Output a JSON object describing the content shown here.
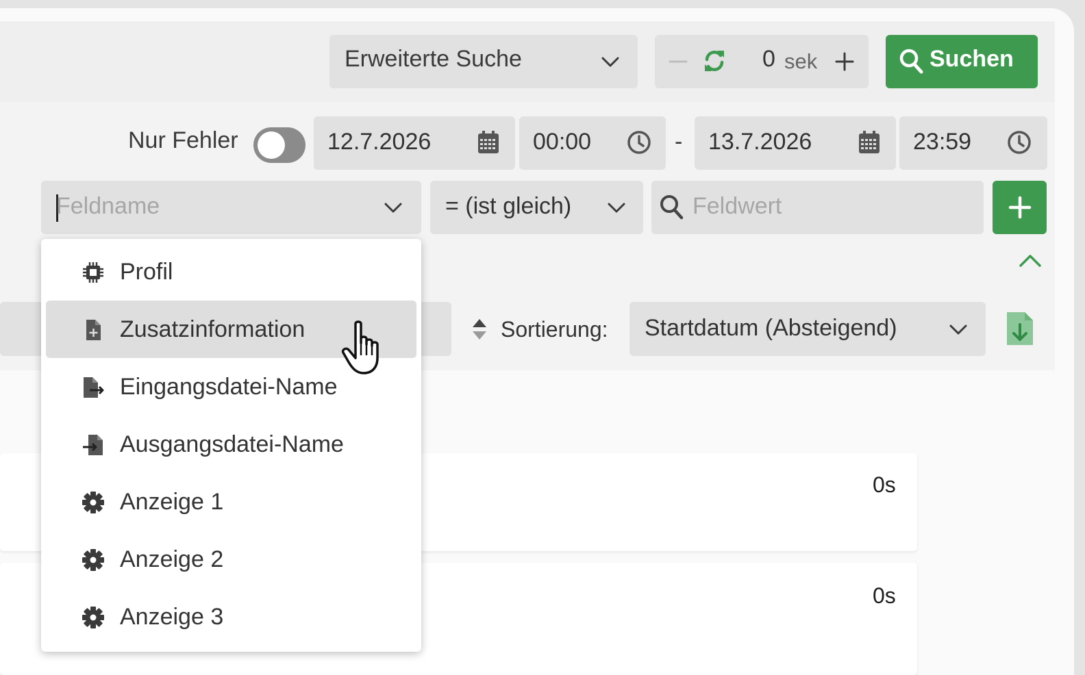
{
  "toolbar": {
    "search_mode": "Erweiterte Suche",
    "refresh_value": "0",
    "refresh_unit": "sek",
    "search_button": "Suchen"
  },
  "filters": {
    "only_errors_label": "Nur Fehler",
    "only_errors_on": false,
    "start_date": "12.7.2026",
    "start_time": "00:00",
    "range_separator": "-",
    "end_date": "13.7.2026",
    "end_time": "23:59"
  },
  "condition": {
    "field_placeholder": "Feldname",
    "operator": "= (ist gleich)",
    "value_placeholder": "Feldwert"
  },
  "sort": {
    "label": "Sortierung:",
    "value": "Startdatum (Absteigend)"
  },
  "results": [
    {
      "duration": "0s"
    },
    {
      "duration": "0s"
    }
  ],
  "field_menu": {
    "items": [
      {
        "label": "Profil",
        "icon": "chip-icon"
      },
      {
        "label": "Zusatzinformation",
        "icon": "file-plus-icon"
      },
      {
        "label": "Eingangsdatei-Name",
        "icon": "file-import-icon"
      },
      {
        "label": "Ausgangsdatei-Name",
        "icon": "file-export-icon"
      },
      {
        "label": "Anzeige 1",
        "icon": "gear-icon"
      },
      {
        "label": "Anzeige 2",
        "icon": "gear-icon"
      },
      {
        "label": "Anzeige 3",
        "icon": "gear-icon"
      }
    ],
    "highlighted": "Zusatzinformation"
  },
  "colors": {
    "accent_green": "#3d9a4f",
    "field_bg": "#e1e1e1",
    "panel_bg": "#efefef"
  }
}
